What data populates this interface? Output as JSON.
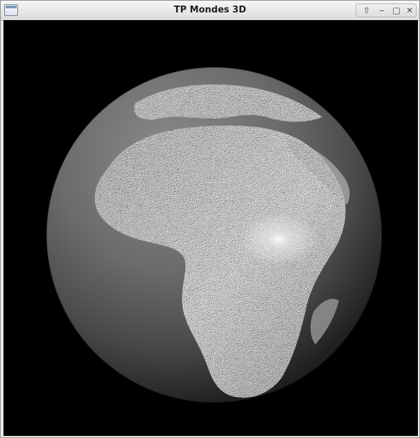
{
  "window": {
    "title": "TP Mondes 3D"
  },
  "titlebar": {
    "controls": {
      "up": "⇧",
      "minimize": "‒",
      "maximize": "□",
      "close": "✕"
    }
  },
  "scene": {
    "description_icon": "globe-icon",
    "background": "#000000"
  }
}
